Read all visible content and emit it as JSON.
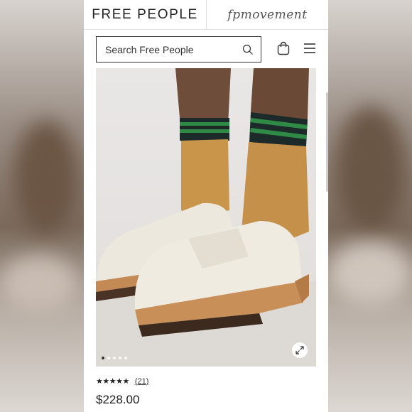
{
  "header": {
    "brand": "FREE PEOPLE",
    "brand_secondary": "fpmovement"
  },
  "search": {
    "placeholder": "Search Free People"
  },
  "product": {
    "image_description": "",
    "gallery_dots": 5,
    "active_dot": 0,
    "rating_stars": "★★★★★",
    "review_count": "(21)",
    "price": "$228.00"
  },
  "icons": {
    "search": "search-icon",
    "bag": "shopping-bag-icon",
    "menu": "hamburger-menu-icon",
    "expand": "expand-icon"
  }
}
